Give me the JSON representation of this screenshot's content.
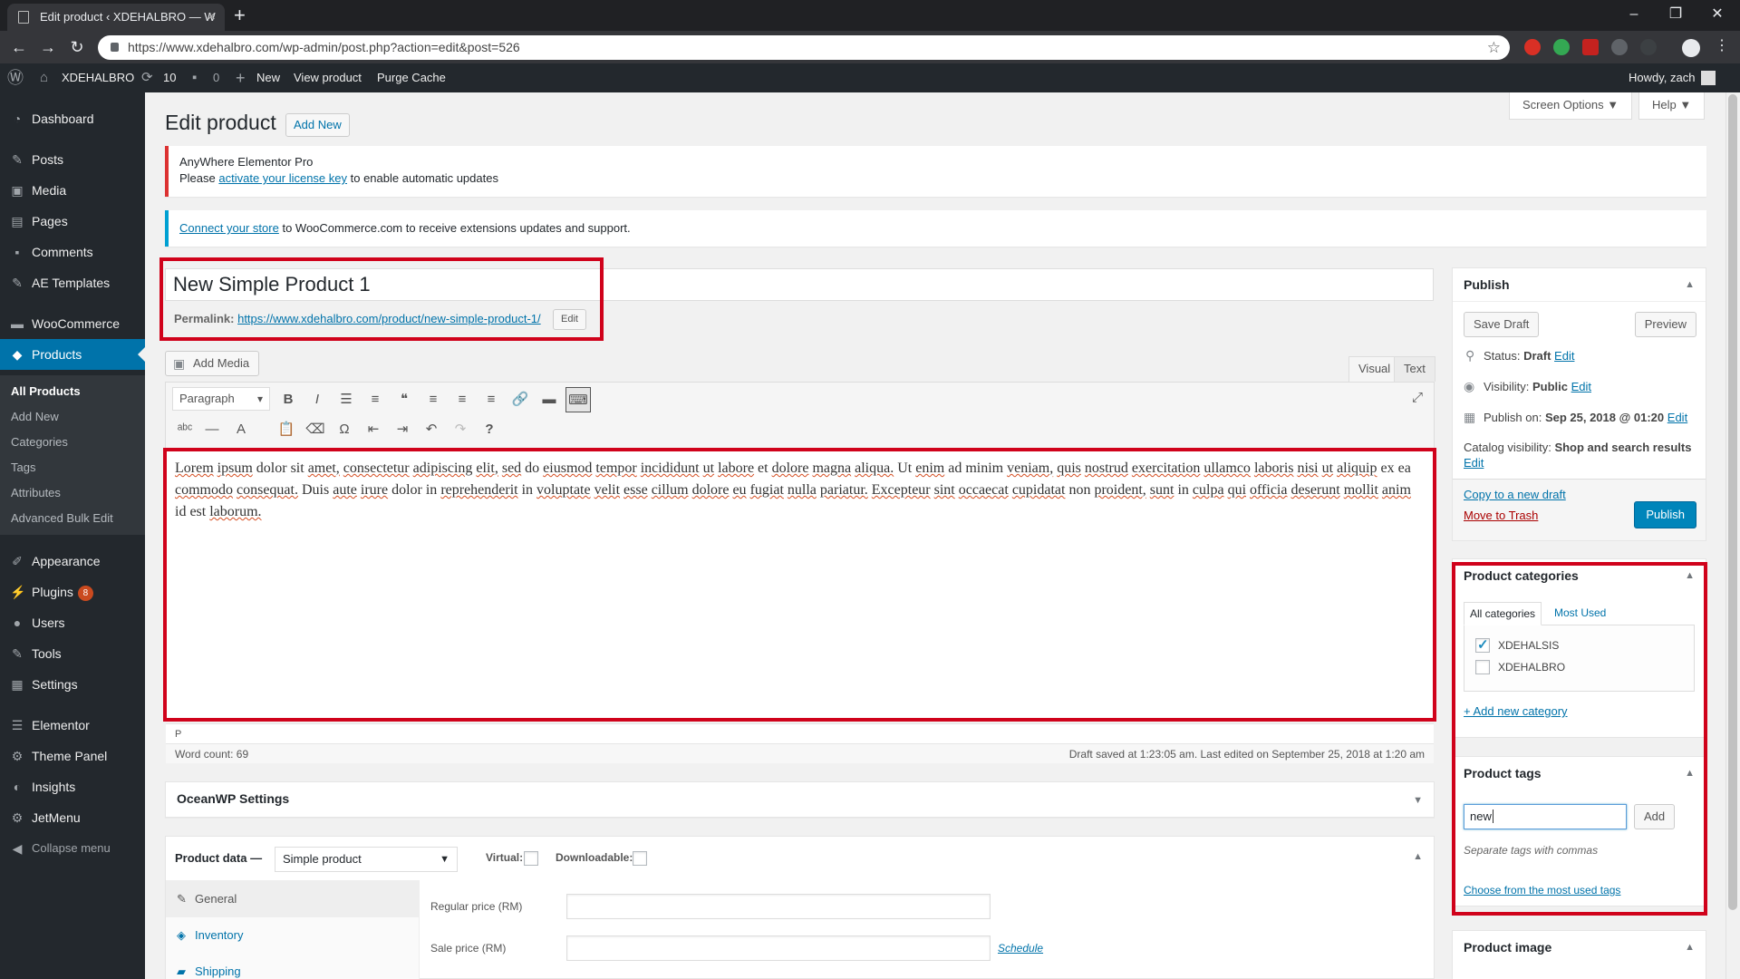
{
  "browser": {
    "tab_title": "Edit product ‹ XDEHALBRO — W",
    "url": "https://www.xdehalbro.com/wp-admin/post.php?action=edit&post=526"
  },
  "adminbar": {
    "site_name": "XDEHALBRO",
    "updates_count": "10",
    "comments_count": "0",
    "new_label": "New",
    "view_label": "View product",
    "purge_label": "Purge Cache",
    "howdy": "Howdy, zach"
  },
  "sidebar": {
    "items": [
      {
        "label": "Dashboard",
        "icon": "dashboard-icon"
      },
      {
        "label": "Posts",
        "icon": "pin-icon"
      },
      {
        "label": "Media",
        "icon": "media-icon"
      },
      {
        "label": "Pages",
        "icon": "pages-icon"
      },
      {
        "label": "Comments",
        "icon": "comment-icon"
      },
      {
        "label": "AE Templates",
        "icon": "pin-icon"
      },
      {
        "label": "WooCommerce",
        "icon": "woo-icon"
      },
      {
        "label": "Products",
        "icon": "products-icon"
      },
      {
        "label": "Appearance",
        "icon": "brush-icon"
      },
      {
        "label": "Plugins",
        "icon": "plugin-icon"
      },
      {
        "label": "Users",
        "icon": "user-icon"
      },
      {
        "label": "Tools",
        "icon": "wrench-icon"
      },
      {
        "label": "Settings",
        "icon": "settings-icon"
      },
      {
        "label": "Elementor",
        "icon": "elementor-icon"
      },
      {
        "label": "Theme Panel",
        "icon": "gear-icon"
      },
      {
        "label": "Insights",
        "icon": "insights-icon"
      },
      {
        "label": "JetMenu",
        "icon": "gear-icon"
      },
      {
        "label": "Collapse menu",
        "icon": "collapse-icon"
      }
    ],
    "plugins_badge": "8",
    "submenu": [
      "All Products",
      "Add New",
      "Categories",
      "Tags",
      "Attributes",
      "Advanced Bulk Edit"
    ]
  },
  "page": {
    "title": "Edit product",
    "add_new": "Add New",
    "screen_options": "Screen Options ▼",
    "help": "Help ▼"
  },
  "notices": {
    "license_title": "AnyWhere Elementor Pro",
    "license_pre": "Please ",
    "license_link": "activate your license key",
    "license_post": " to enable automatic updates",
    "woo_link": "Connect your store",
    "woo_post": " to WooCommerce.com to receive extensions updates and support."
  },
  "post": {
    "title": "New Simple Product 1",
    "permalink_label": "Permalink: ",
    "permalink_url": "https://www.xdehalbro.com/product/new-simple-product-1/",
    "permalink_edit": "Edit",
    "add_media": "Add Media",
    "tab_visual": "Visual",
    "tab_text": "Text",
    "format": "Paragraph",
    "path": "P",
    "word_count": "Word count: 69",
    "draft_status": "Draft saved at 1:23:05 am. Last edited on September 25, 2018 at 1:20 am"
  },
  "content_words": [
    "Lorem",
    "ipsum",
    "dolor",
    "sit",
    "amet,",
    "consectetur",
    "adipiscing",
    "elit,",
    "sed",
    "do",
    "eiusmod",
    "tempor",
    "incididunt",
    "ut",
    "labore",
    "et",
    "dolore",
    "magna",
    "aliqua.",
    "Ut",
    "enim",
    "ad",
    "minim",
    "veniam,",
    "quis",
    "nostrud",
    "exercitation",
    "ullamco",
    "laboris",
    "nisi",
    "ut",
    "aliquip",
    "ex",
    "ea",
    "commodo",
    "consequat.",
    "Duis",
    "aute",
    "irure",
    "dolor",
    "in",
    "reprehenderit",
    "in",
    "voluptate",
    "velit",
    "esse",
    "cillum",
    "dolore",
    "eu",
    "fugiat",
    "nulla",
    "pariatur.",
    "Excepteur",
    "sint",
    "occaecat",
    "cupidatat",
    "non",
    "proident,",
    "sunt",
    "in",
    "culpa",
    "qui",
    "officia",
    "deserunt",
    "mollit",
    "anim",
    "id",
    "est",
    "laborum."
  ],
  "misspelled": [
    "Lorem",
    "ipsum",
    "amet,",
    "consectetur",
    "adipiscing",
    "elit,",
    "sed",
    "eiusmod",
    "tempor",
    "incididunt",
    "ut",
    "labore",
    "dolore",
    "magna",
    "aliqua.",
    "enim",
    "veniam,",
    "quis",
    "nostrud",
    "exercitation",
    "ullamco",
    "laboris",
    "nisi",
    "aliquip",
    "commodo",
    "consequat.",
    "aute",
    "irure",
    "reprehenderit",
    "voluptate",
    "velit",
    "esse",
    "cillum",
    "eu",
    "fugiat",
    "nulla",
    "pariatur.",
    "Excepteur",
    "sint",
    "occaecat",
    "cupidatat",
    "proident,",
    "sunt",
    "culpa",
    "qui",
    "officia",
    "deserunt",
    "mollit",
    "anim",
    "laborum."
  ],
  "oceanwp": {
    "title": "OceanWP Settings"
  },
  "product_data": {
    "label": "Product data —",
    "type": "Simple product",
    "virtual_label": "Virtual:",
    "downloadable_label": "Downloadable:",
    "tabs": [
      "General",
      "Inventory",
      "Shipping"
    ],
    "regular_price_label": "Regular price (RM)",
    "sale_price_label": "Sale price (RM)",
    "schedule": "Schedule"
  },
  "publish": {
    "title": "Publish",
    "save_draft": "Save Draft",
    "preview": "Preview",
    "status_label": "Status: ",
    "status_value": "Draft",
    "visibility_label": "Visibility: ",
    "visibility_value": "Public",
    "publish_on_label": "Publish on: ",
    "publish_on_value": "Sep 25, 2018 @ 01:20",
    "catalog_label": "Catalog visibility: ",
    "catalog_value": "Shop and search results",
    "edit": "Edit",
    "copy_draft": "Copy to a new draft",
    "trash": "Move to Trash",
    "publish_btn": "Publish"
  },
  "categories": {
    "title": "Product categories",
    "tab_all": "All categories",
    "tab_used": "Most Used",
    "items": [
      {
        "name": "XDEHALSIS",
        "checked": true
      },
      {
        "name": "XDEHALBRO",
        "checked": false
      }
    ],
    "add_new": "+ Add new category"
  },
  "tags": {
    "title": "Product tags",
    "input_value": "new",
    "add": "Add",
    "hint": "Separate tags with commas",
    "choose": "Choose from the most used tags"
  },
  "product_image": {
    "title": "Product image"
  },
  "colors": {
    "accent": "#0073aa",
    "annotation": "#d0021b",
    "admin_dark": "#23282d"
  }
}
